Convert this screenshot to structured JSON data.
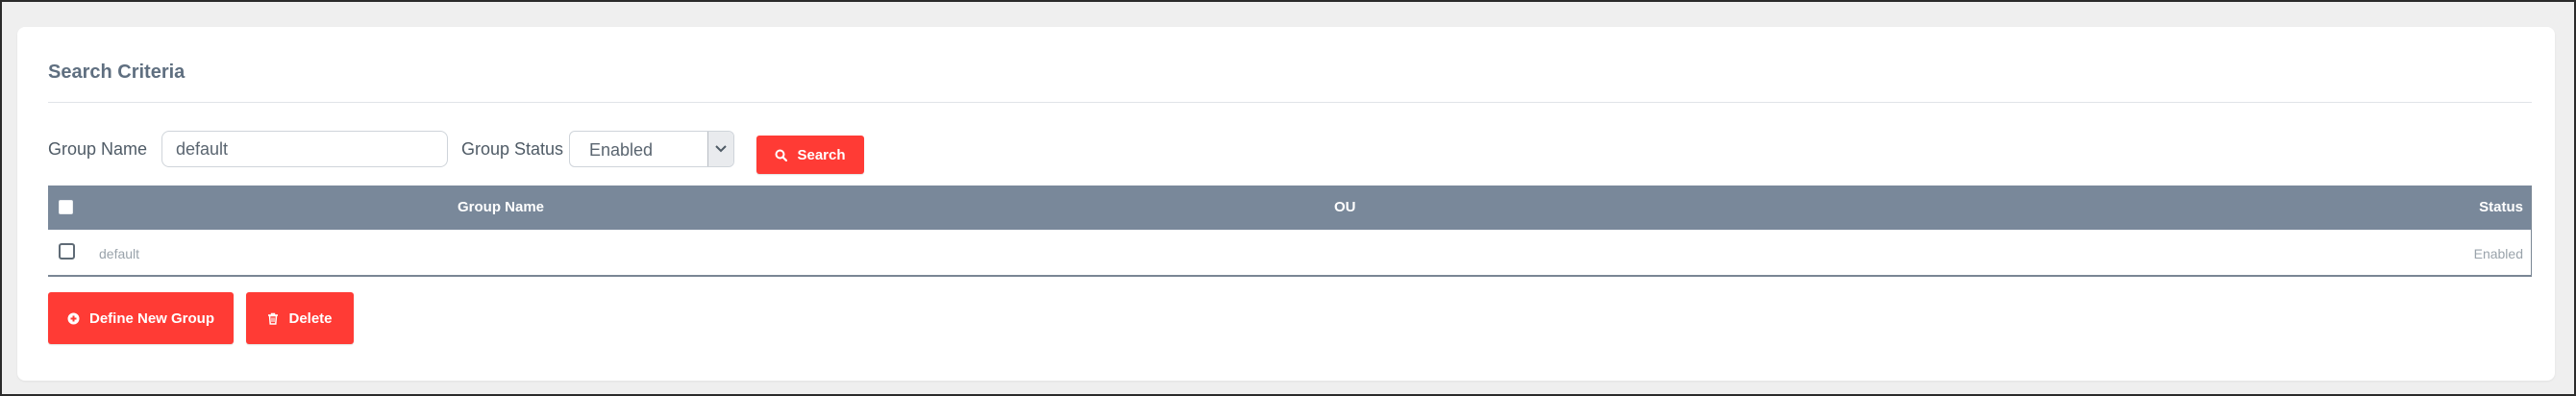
{
  "panel": {
    "title": "Search Criteria"
  },
  "filters": {
    "group_name_label": "Group Name",
    "group_name_value": "default",
    "group_status_label": "Group Status",
    "group_status_value": "Enabled",
    "search_button": "Search"
  },
  "table": {
    "columns": [
      "Group Name",
      "OU",
      "Status"
    ],
    "rows": [
      {
        "group_name": "default",
        "ou": "",
        "status": "Enabled",
        "selected": false
      }
    ]
  },
  "actions": {
    "define_new_group": "Define New Group",
    "delete": "Delete"
  },
  "colors": {
    "accent": "#ff3b35",
    "table_header": "#79889a",
    "title_text": "#5f6f80"
  },
  "icons": {
    "search": "search-icon",
    "add": "plus-circle-icon",
    "delete": "trash-icon",
    "dropdown": "chevron-down-icon"
  }
}
